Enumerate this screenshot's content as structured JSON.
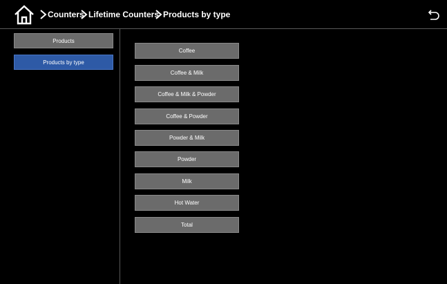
{
  "colors": {
    "background": "#000000",
    "button": "#6b6b6b",
    "active": "#2e5aa6",
    "text": "#ffffff"
  },
  "header": {
    "home_icon": "home-icon",
    "back_icon": "back-arrow-icon",
    "breadcrumbs": [
      "Counters",
      "Lifetime Counters",
      "Products by type"
    ]
  },
  "sidebar": {
    "items": [
      {
        "label": "Products",
        "active": false
      },
      {
        "label": "Products by type",
        "active": true
      }
    ]
  },
  "main": {
    "types": [
      "Coffee",
      "Coffee & Milk",
      "Coffee & Milk & Powder",
      "Coffee & Powder",
      "Powder & Milk",
      "Powder",
      "Milk",
      "Hot Water",
      "Total"
    ]
  }
}
